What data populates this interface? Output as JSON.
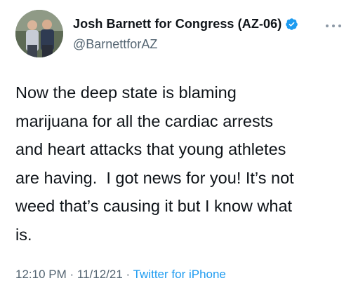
{
  "author": {
    "display_name": "Josh Barnett for Congress (AZ-06)",
    "handle": "@BarnettforAZ",
    "verified_icon": "verified-badge-icon",
    "avatar": "avatar-photo"
  },
  "more_icon": "more-options-icon",
  "tweet": {
    "text": "Now the deep state is blaming\nmarijuana for all the cardiac arrests\nand heart attacks that young athletes\nare having.  I got news for you! It’s not\nweed that’s causing it but I know what\nis."
  },
  "meta": {
    "time": "12:10 PM",
    "separator": " · ",
    "date": "11/12/21",
    "source": "Twitter for iPhone"
  },
  "colors": {
    "text": "#0f1419",
    "secondary": "#536471",
    "link": "#1d9bf0",
    "verified": "#1d9bf0"
  }
}
